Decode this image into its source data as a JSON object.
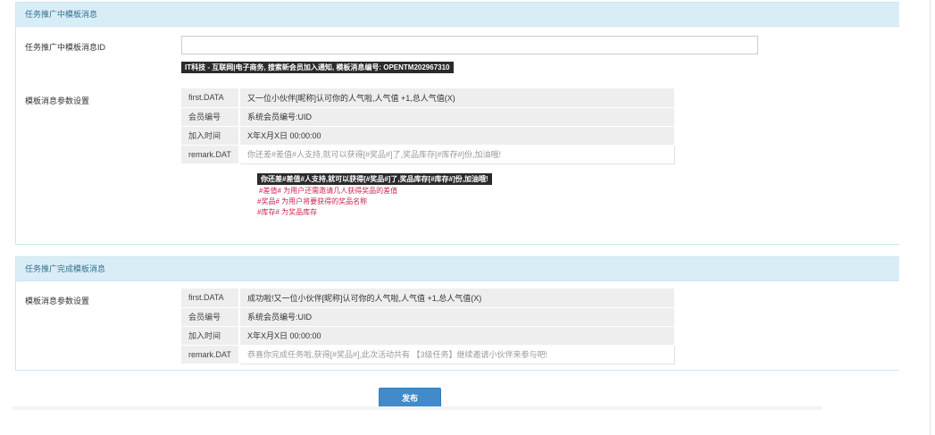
{
  "panel1": {
    "title": "任务推广中模板消息",
    "template_id_label": "任务推广中模板消息ID",
    "template_id_value": "",
    "template_hint": "IT科技 - 互联网|电子商务, 搜索新会员加入通知, 模板消息编号: OPENTM202967310",
    "params_label": "模板消息参数设置",
    "rows": [
      {
        "key": "first.DATA",
        "value": "又一位小伙伴[昵称]认可你的人气啦,人气值 +1,总人气值(X)"
      },
      {
        "key": "会员编号",
        "value": "系统会员编号:UID"
      },
      {
        "key": "加入时间",
        "value": "X年X月X日 00:00:00"
      },
      {
        "key": "remark.DAT",
        "value": "你还差#差值#人支持,就可以获得[#奖品#]了,奖品库存[#库存#]份,加油哦!"
      }
    ],
    "remark_hint": "你还差#差值#人支持,就可以获得[#奖品#]了,奖品库存[#库存#]份,加油哦!",
    "legend": [
      "#差值# 为用户还需邀请几人获得奖品的差值",
      "#奖品# 为用户将要获得的奖品名称",
      "#库存# 为奖品库存"
    ]
  },
  "panel2": {
    "title": "任务推广完成模板消息",
    "params_label": "模板消息参数设置",
    "rows": [
      {
        "key": "first.DATA",
        "value": "成功啦!又一位小伙伴[昵称]认可你的人气啦,人气值 +1,总人气值(X)"
      },
      {
        "key": "会员编号",
        "value": "系统会员编号:UID"
      },
      {
        "key": "加入时间",
        "value": "X年X月X日 00:00:00"
      },
      {
        "key": "remark.DAT",
        "value": "恭喜你完成任务啦,获得[#奖品#],此次活动共有 【3级任务】继续邀请小伙伴来参与吧!"
      }
    ]
  },
  "publish_label": "发布"
}
